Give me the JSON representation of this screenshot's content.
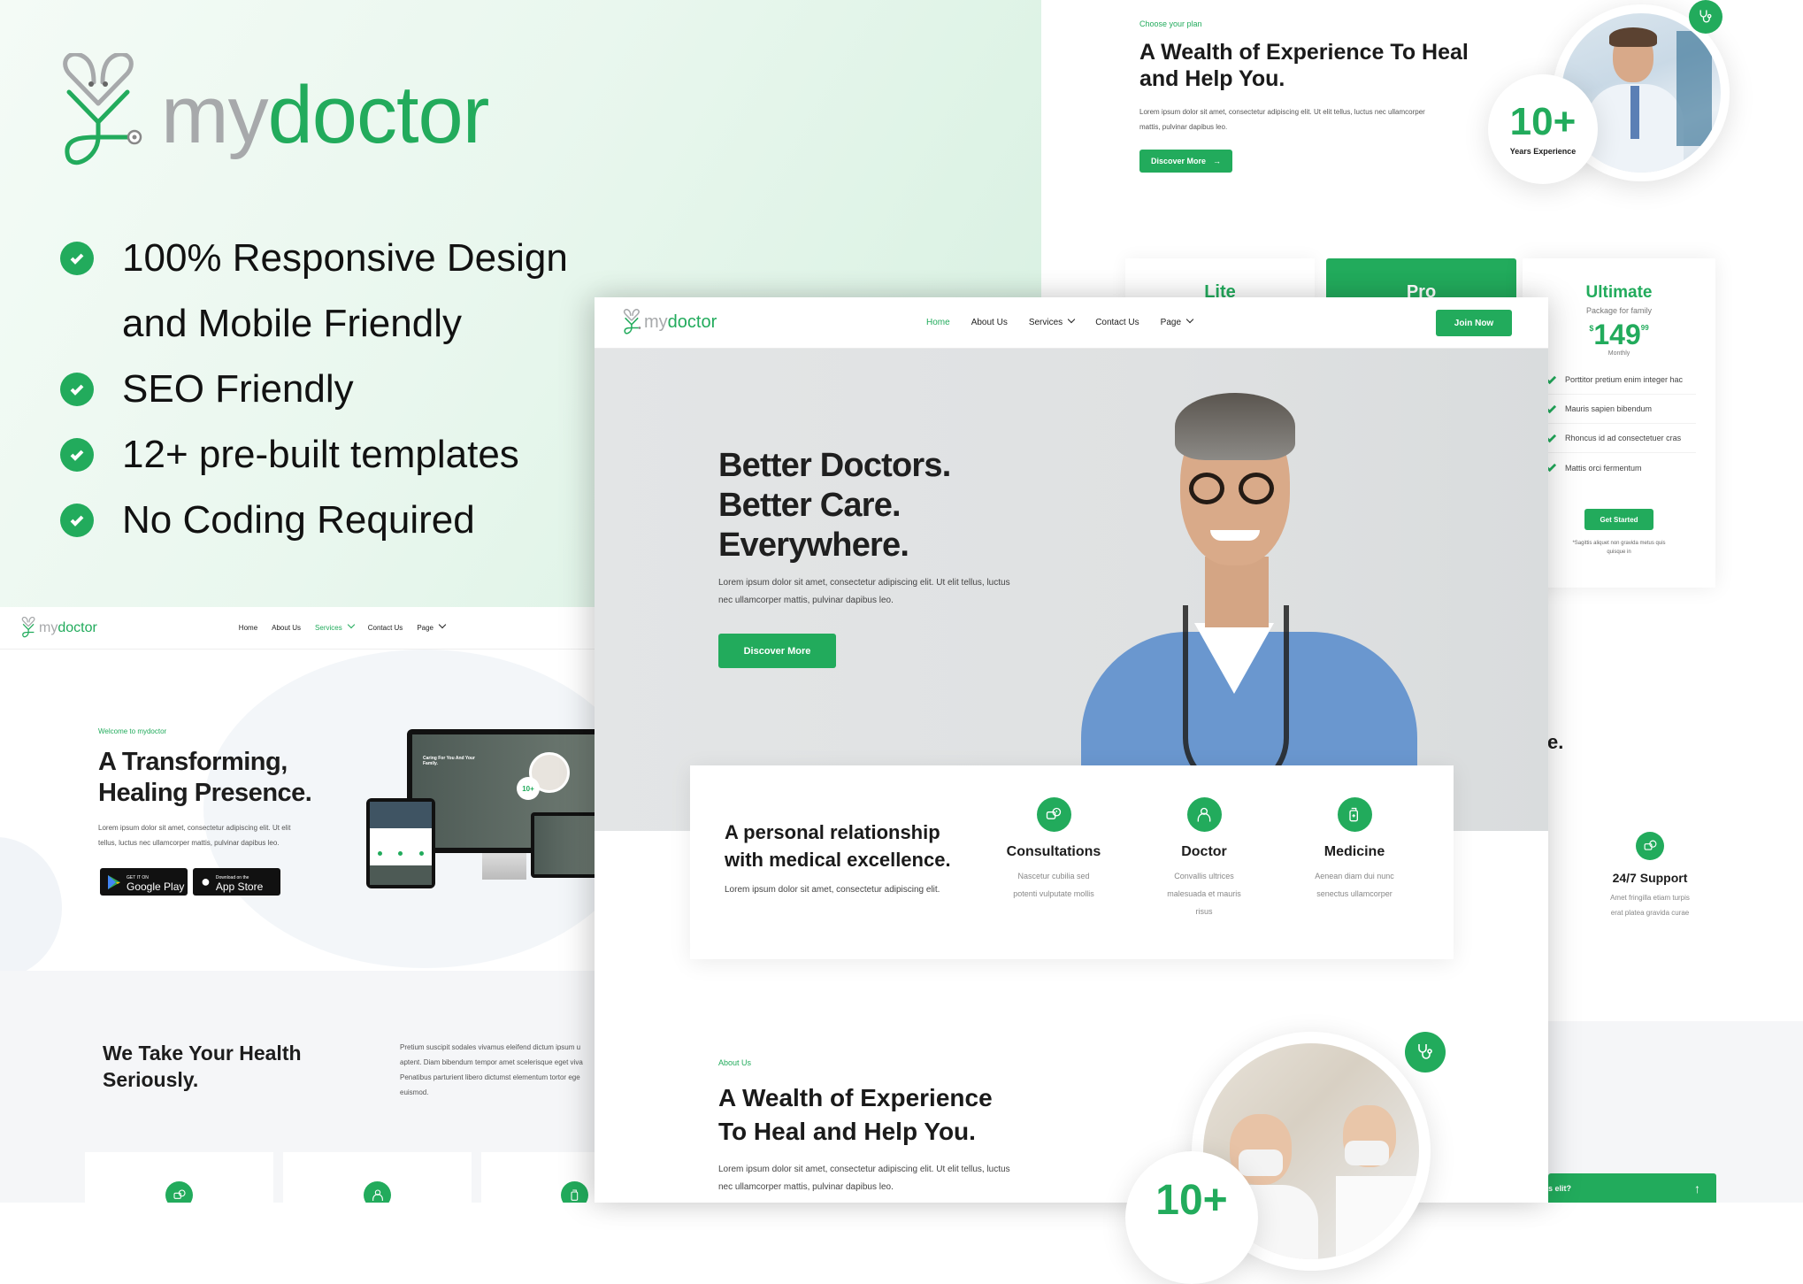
{
  "promo": {
    "logo": {
      "my": "my",
      "doctor": "doctor"
    },
    "features": [
      {
        "line1": "100% Responsive Design",
        "line2": "and Mobile Friendly"
      },
      {
        "line1": "SEO Friendly"
      },
      {
        "line1": "12+ pre-built templates"
      },
      {
        "line1": "No Coding Required"
      }
    ]
  },
  "plan_page": {
    "eyebrow": "Choose your plan",
    "title_line1": "A Wealth of Experience To Heal",
    "title_line2": "and Help You.",
    "body_line1": "Lorem ipsum dolor sit amet, consectetur adipiscing elit. Ut elit tellus, luctus nec ullamcorper",
    "body_line2": "mattis, pulvinar dapibus leo.",
    "discover_label": "Discover More",
    "experience_number": "10+",
    "experience_label": "Years Experience",
    "plans": [
      {
        "name": "Lite"
      },
      {
        "name": "Pro"
      },
      {
        "name": "Ultimate",
        "subtitle": "Package for family",
        "currency": "$",
        "price": "149",
        "cents": "99",
        "period": "Monthly",
        "features": [
          "Porttitor pretium enim integer hac",
          "Mauris sapien bibendum",
          "Rhoncus id ad consectetuer cras",
          "Mattis orci fermentum"
        ],
        "cta": "Get Started",
        "note_line1": "*Sagittis aliquet non gravida metus quis",
        "note_line2": "quisque in"
      }
    ],
    "support": {
      "title": "24/7 Support",
      "line1": "Amet fringilla etiam turpis",
      "line2": "erat platea gravida curae"
    },
    "faq_fragment": "s elit?",
    "hero_fragment": "e."
  },
  "main": {
    "logo": {
      "my": "my",
      "doctor": "doctor"
    },
    "nav": [
      {
        "label": "Home",
        "active": true,
        "dropdown": false
      },
      {
        "label": "About Us",
        "active": false,
        "dropdown": false
      },
      {
        "label": "Services",
        "active": false,
        "dropdown": true
      },
      {
        "label": "Contact Us",
        "active": false,
        "dropdown": false
      },
      {
        "label": "Page",
        "active": false,
        "dropdown": true
      }
    ],
    "join_label": "Join Now",
    "hero": {
      "line1": "Better Doctors.",
      "line2": "Better Care.",
      "line3": "Everywhere.",
      "body_line1": "Lorem ipsum dolor sit amet, consectetur adipiscing elit. Ut elit tellus, luctus",
      "body_line2": "nec ullamcorper mattis, pulvinar dapibus leo.",
      "cta": "Discover More"
    },
    "features_card": {
      "title_line1": "A personal relationship",
      "title_line2": "with medical excellence.",
      "body": "Lorem ipsum dolor sit amet, consectetur adipiscing elit.",
      "items": [
        {
          "icon": "consultation-icon",
          "title": "Consultations",
          "lines": [
            "Nascetur cubilia sed",
            "potenti vulputate mollis"
          ]
        },
        {
          "icon": "doctor-icon",
          "title": "Doctor",
          "lines": [
            "Convallis ultrices",
            "malesuada et mauris",
            "risus"
          ]
        },
        {
          "icon": "medicine-icon",
          "title": "Medicine",
          "lines": [
            "Aenean diam dui nunc",
            "senectus ullamcorper"
          ]
        }
      ]
    },
    "about": {
      "eyebrow": "About Us",
      "title_line1": "A Wealth of Experience",
      "title_line2": "To Heal and Help You.",
      "body_line1": "Lorem ipsum dolor sit amet, consectetur adipiscing elit. Ut elit tellus, luctus",
      "body_line2": "nec ullamcorper mattis, pulvinar dapibus leo.",
      "experience_number": "10+"
    }
  },
  "left_page": {
    "logo": {
      "my": "my",
      "doctor": "doctor"
    },
    "nav": [
      {
        "label": "Home",
        "active": false,
        "dropdown": false
      },
      {
        "label": "About Us",
        "active": false,
        "dropdown": false
      },
      {
        "label": "Services",
        "active": true,
        "dropdown": true
      },
      {
        "label": "Contact Us",
        "active": false,
        "dropdown": false
      },
      {
        "label": "Page",
        "active": false,
        "dropdown": true
      }
    ],
    "eyebrow": "Welcome to mydoctor",
    "title_line1": "A Transforming,",
    "title_line2": "Healing Presence.",
    "body_line1": "Lorem ipsum dolor sit amet, consectetur adipiscing elit. Ut elit",
    "body_line2": "tellus, luctus nec ullamcorper mattis, pulvinar dapibus leo.",
    "google_play": {
      "small": "GET IT ON",
      "big": "Google Play"
    },
    "app_store": {
      "small": "Download on the",
      "big": "App Store"
    },
    "device_mockup": {
      "headline": "Caring For You And Your Family.",
      "badge": "10+"
    },
    "health": {
      "title_line1": "We Take Your Health",
      "title_line2": "Seriously.",
      "body_lines": [
        "Pretium suscipit sodales vivamus eleifend dictum ipsum u",
        "aptent. Diam bibendum tempor amet scelerisque eget viva",
        "Penatibus parturient libero dictumst elementum tortor ege",
        "euismod."
      ]
    }
  },
  "colors": {
    "accent": "#22ab5c",
    "logo_grey": "#a7a9ab",
    "hero_bg": "#e0e2e3",
    "promo_bg": "#e9f7ee"
  }
}
